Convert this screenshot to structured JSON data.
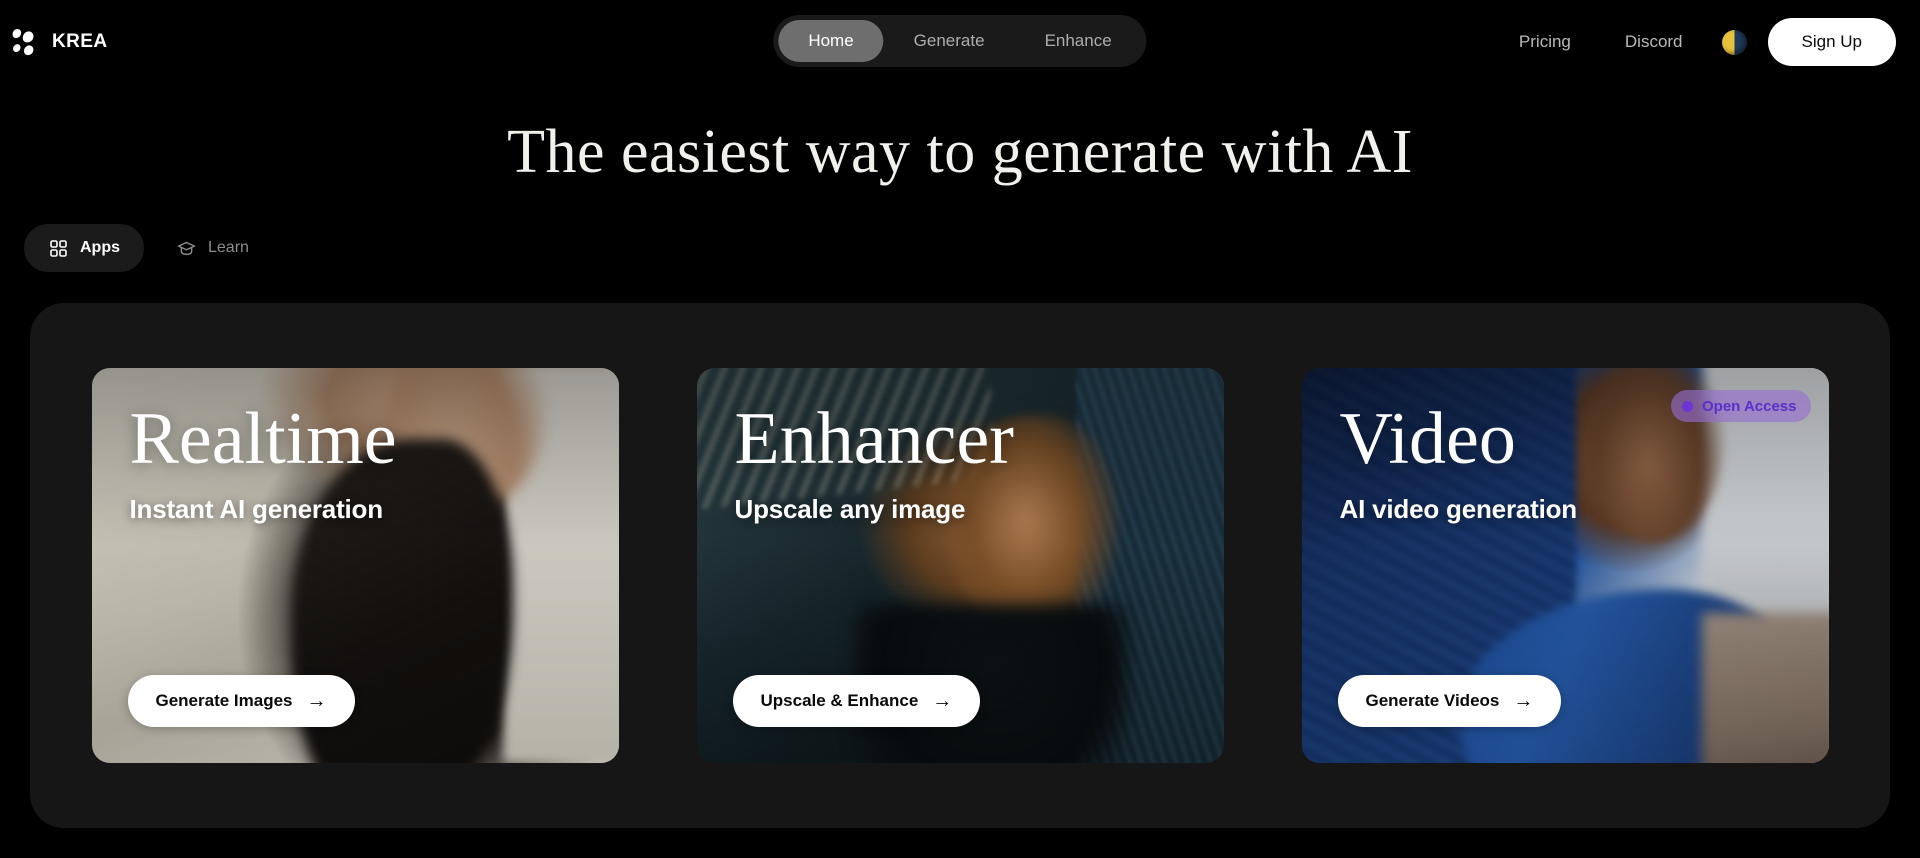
{
  "brand": {
    "name": "KREA",
    "logo_icon": "krea-logo-icon"
  },
  "nav": {
    "items": [
      {
        "label": "Home",
        "active": true
      },
      {
        "label": "Generate",
        "active": false
      },
      {
        "label": "Enhance",
        "active": false
      }
    ]
  },
  "nav_right": {
    "links": [
      {
        "label": "Pricing"
      },
      {
        "label": "Discord"
      }
    ],
    "theme_toggle_icon": "moon-icon",
    "signup_label": "Sign Up"
  },
  "hero": {
    "title": "The easiest way to generate with AI"
  },
  "tabs": [
    {
      "label": "Apps",
      "icon": "grid-icon",
      "active": true
    },
    {
      "label": "Learn",
      "icon": "graduation-cap-icon",
      "active": false
    }
  ],
  "cards": [
    {
      "title": "Realtime",
      "subtitle": "Instant AI generation",
      "cta": "Generate Images",
      "cta_arrow": "→",
      "badge": null
    },
    {
      "title": "Enhancer",
      "subtitle": "Upscale any image",
      "cta": "Upscale & Enhance",
      "cta_arrow": "→",
      "badge": null
    },
    {
      "title": "Video",
      "subtitle": "AI video generation",
      "cta": "Generate Videos",
      "cta_arrow": "→",
      "badge": "Open Access"
    }
  ],
  "colors": {
    "page_background": "#000000",
    "panel_background": "#161616",
    "nav_pill_background": "#1a1a1a",
    "nav_active_background": "#6e6e6e",
    "accent_white": "#ffffff",
    "badge_text": "#5b2fc9",
    "badge_dot": "#6d35d8",
    "badge_background": "rgba(150,110,210,0.62)",
    "muted_text": "#adadad"
  }
}
